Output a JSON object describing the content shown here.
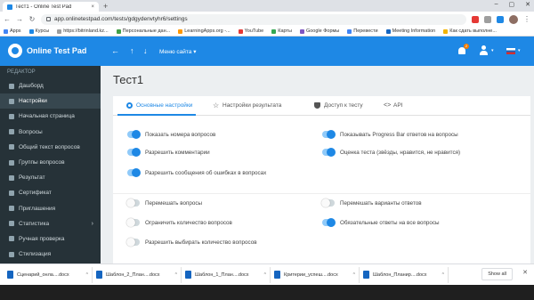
{
  "browser": {
    "tab_title": "Тест1 - Online Test Pad",
    "tab_close": "×",
    "new_tab": "+",
    "window_controls": [
      "–",
      "▢",
      "✕"
    ],
    "url": "app.onlinetestpad.com/tests/gdgydenvtyhr6/settings",
    "bookmarks": [
      {
        "label": "Apps",
        "color": "#4285f4"
      },
      {
        "label": "Курсы",
        "color": "#1e88e5"
      },
      {
        "label": "https://bitrinland.kz...",
        "color": "#9e9e9e"
      },
      {
        "label": "Персональные дан...",
        "color": "#43a047"
      },
      {
        "label": "LearningApps.org -...",
        "color": "#ff9800"
      },
      {
        "label": "YouTube",
        "color": "#e53935"
      },
      {
        "label": "Карты",
        "color": "#34a853"
      },
      {
        "label": "Google Формы",
        "color": "#7e57c2"
      },
      {
        "label": "Перевести",
        "color": "#4285f4"
      },
      {
        "label": "Meeting Information",
        "color": "#1565c0"
      },
      {
        "label": "Как сдать выполне...",
        "color": "#f4b400"
      }
    ]
  },
  "header": {
    "brand": "Online Test Pad",
    "back_icon": "←",
    "sort_up_icon": "↑",
    "sort_down_icon": "↓",
    "menu_label": "Меню сайта ▾",
    "notification_count": "2",
    "user_caret": "▾",
    "lang_caret": "▾"
  },
  "sidebar": {
    "heading": "РЕДАКТОР",
    "items": [
      {
        "label": "Дашборд",
        "active": false
      },
      {
        "label": "Настройки",
        "active": true
      },
      {
        "label": "Начальная страница",
        "active": false
      },
      {
        "label": "Вопросы",
        "active": false
      },
      {
        "label": "Общий текст вопросов",
        "active": false
      },
      {
        "label": "Группы вопросов",
        "active": false
      },
      {
        "label": "Результат",
        "active": false
      },
      {
        "label": "Сертификат",
        "active": false
      },
      {
        "label": "Приглашения",
        "active": false
      },
      {
        "label": "Статистика",
        "active": false,
        "chevron": "›"
      },
      {
        "label": "Ручная проверка",
        "active": false
      },
      {
        "label": "Стилизация",
        "active": false
      }
    ]
  },
  "main": {
    "title": "Тест1",
    "tabs": [
      {
        "label": "Основные настройки"
      },
      {
        "label": "Настройки результата"
      },
      {
        "label": "Доступ к тесту"
      },
      {
        "label": "API"
      }
    ],
    "options_left": [
      {
        "label": "Показать номера вопросов",
        "on": true
      },
      {
        "label": "Разрешить комментарии",
        "on": true
      },
      {
        "label": "Разрешить сообщения об ошибках в вопросах",
        "on": true
      },
      {
        "label": "Перемешать вопросы",
        "on": false
      },
      {
        "label": "Ограничить количество вопросов",
        "on": false
      },
      {
        "label": "Разрешить выбирать количество вопросов",
        "on": false
      }
    ],
    "options_right": [
      {
        "label": "Показывать Progress Bar ответов на вопросы",
        "on": true
      },
      {
        "label": "Оценка теста (звёзды, нравится, не нравится)",
        "on": true
      },
      {
        "label": "Перемешать варианты ответов",
        "on": false
      },
      {
        "label": "Обязательные ответы на все вопросы",
        "on": true
      }
    ]
  },
  "downloads": {
    "items": [
      {
        "label": "Сценарий_онла....docx"
      },
      {
        "label": "Шаблон_2_План....docx"
      },
      {
        "label": "Шаблон_1_План....docx"
      },
      {
        "label": "Критерии_успеш....docx"
      },
      {
        "label": "Шаблон_Планир....docx"
      }
    ],
    "caret": "^",
    "show_all": "Show all",
    "close": "✕"
  }
}
